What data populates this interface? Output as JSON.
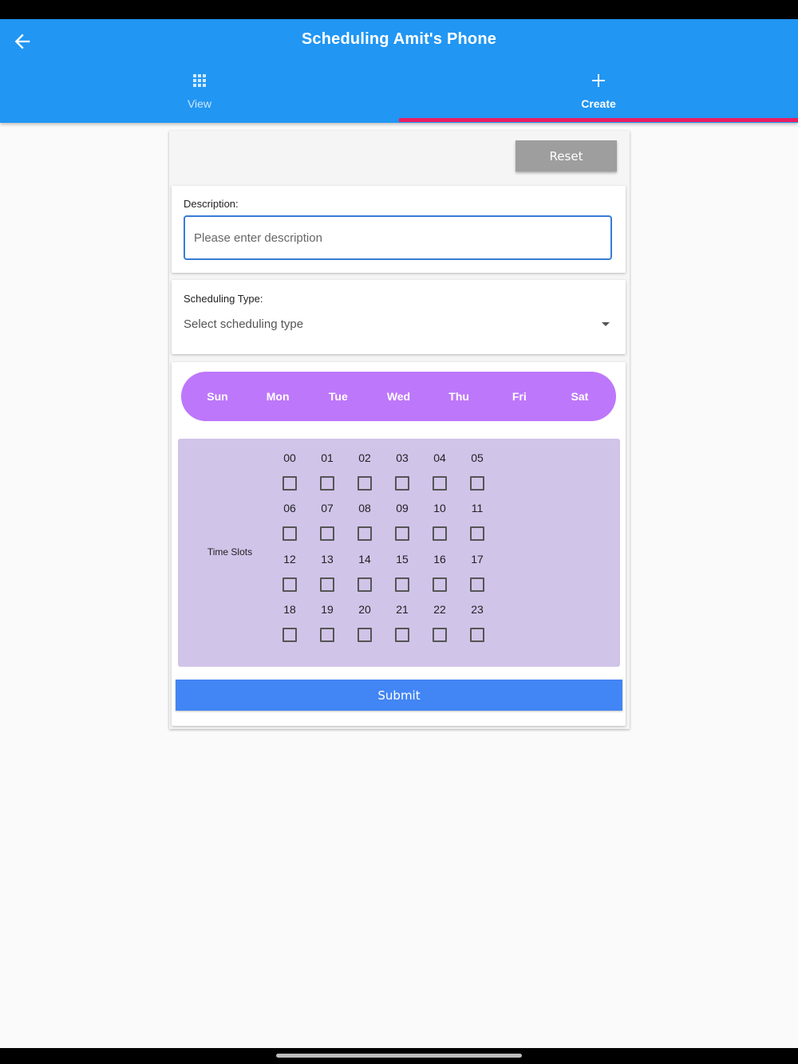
{
  "appbar": {
    "title": "Scheduling Amit's Phone",
    "background_color": "#2196f3",
    "back_icon": "arrow-left-icon"
  },
  "tabs": [
    {
      "label": "View",
      "icon": "grid-icon",
      "selected": false
    },
    {
      "label": "Create",
      "icon": "plus-icon",
      "selected": true
    }
  ],
  "indicator_color": "#e91e63",
  "form": {
    "reset_label": "Reset",
    "description": {
      "label": "Description:",
      "placeholder": "Please enter description",
      "value": ""
    },
    "scheduling_type": {
      "label": "Scheduling Type:",
      "placeholder": "Select scheduling type",
      "icon": "dropdown-arrow-icon"
    },
    "days": [
      "Sun",
      "Mon",
      "Tue",
      "Wed",
      "Thu",
      "Fri",
      "Sat"
    ],
    "days_color": "#bd77fb",
    "time_slots": {
      "label": "Time Slots",
      "slots": [
        "00",
        "01",
        "02",
        "03",
        "04",
        "05",
        "06",
        "07",
        "08",
        "09",
        "10",
        "11",
        "12",
        "13",
        "14",
        "15",
        "16",
        "17",
        "18",
        "19",
        "20",
        "21",
        "22",
        "23"
      ],
      "checked": [],
      "background_color": "#d1c4e9"
    },
    "submit_label": "Submit",
    "submit_color": "#4285f4"
  }
}
